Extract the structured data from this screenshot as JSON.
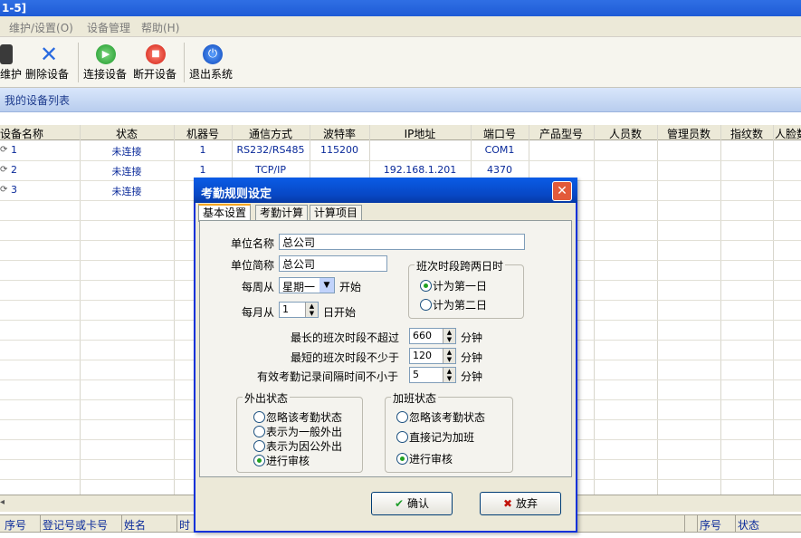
{
  "window": {
    "title": "1-5]"
  },
  "menu": [
    "维护/设置(O)",
    "设备管理",
    "帮助(H)"
  ],
  "toolbar": [
    {
      "label": "维护",
      "icon": "maintenance-icon"
    },
    {
      "label": "删除设备",
      "icon": "delete-x-icon"
    },
    {
      "label": "连接设备",
      "icon": "connect-play-icon"
    },
    {
      "label": "断开设备",
      "icon": "disconnect-stop-icon"
    },
    {
      "label": "退出系统",
      "icon": "power-icon"
    }
  ],
  "device_list_label": "我的设备列表",
  "grid": {
    "headers": [
      "设备名称",
      "状态",
      "机器号",
      "通信方式",
      "波特率",
      "IP地址",
      "端口号",
      "产品型号",
      "人员数",
      "管理员数",
      "指纹数",
      "人脸数"
    ],
    "rows": [
      [
        "1",
        "未连接",
        "1",
        "RS232/RS485",
        "115200",
        "",
        "COM1"
      ],
      [
        "2",
        "未连接",
        "1",
        "TCP/IP",
        "",
        "192.168.1.201",
        "4370"
      ],
      [
        "3",
        "未连接",
        "",
        "",
        "",
        "",
        ""
      ]
    ]
  },
  "bottom": {
    "left_headers": [
      "序号",
      "登记号或卡号",
      "姓名",
      "时"
    ],
    "right_headers": [
      "序号",
      "状态"
    ]
  },
  "dialog": {
    "title": "考勤规则设定",
    "tabs": [
      "基本设置",
      "考勤计算",
      "计算项目"
    ],
    "company_name_label": "单位名称",
    "company_name_value": "总公司",
    "company_short_label": "单位简称",
    "company_short_value": "总公司",
    "week_from_label": "每周从",
    "week_from_value": "星期一",
    "week_start_suffix": "开始",
    "month_from_label": "每月从",
    "month_from_value": "1",
    "month_start_suffix": "日开始",
    "cross_day_group": "班次时段跨两日时",
    "cross_day_options": [
      {
        "label": "计为第一日",
        "checked": true
      },
      {
        "label": "计为第二日",
        "checked": false
      }
    ],
    "max_shift_label": "最长的班次时段不超过",
    "max_shift_value": "660",
    "min_shift_label": "最短的班次时段不少于",
    "min_shift_value": "120",
    "interval_label": "有效考勤记录间隔时间不小于",
    "interval_value": "5",
    "minute_unit": "分钟",
    "outing_group": "外出状态",
    "outing_options": [
      {
        "label": "忽略该考勤状态",
        "checked": false
      },
      {
        "label": "表示为一般外出",
        "checked": false
      },
      {
        "label": "表示为因公外出",
        "checked": false
      },
      {
        "label": "进行审核",
        "checked": true
      }
    ],
    "overtime_group": "加班状态",
    "overtime_options": [
      {
        "label": "忽略该考勤状态",
        "checked": false
      },
      {
        "label": "直接记为加班",
        "checked": false
      },
      {
        "label": "进行审核",
        "checked": true
      }
    ],
    "ok_label": "确认",
    "cancel_label": "放弃"
  }
}
